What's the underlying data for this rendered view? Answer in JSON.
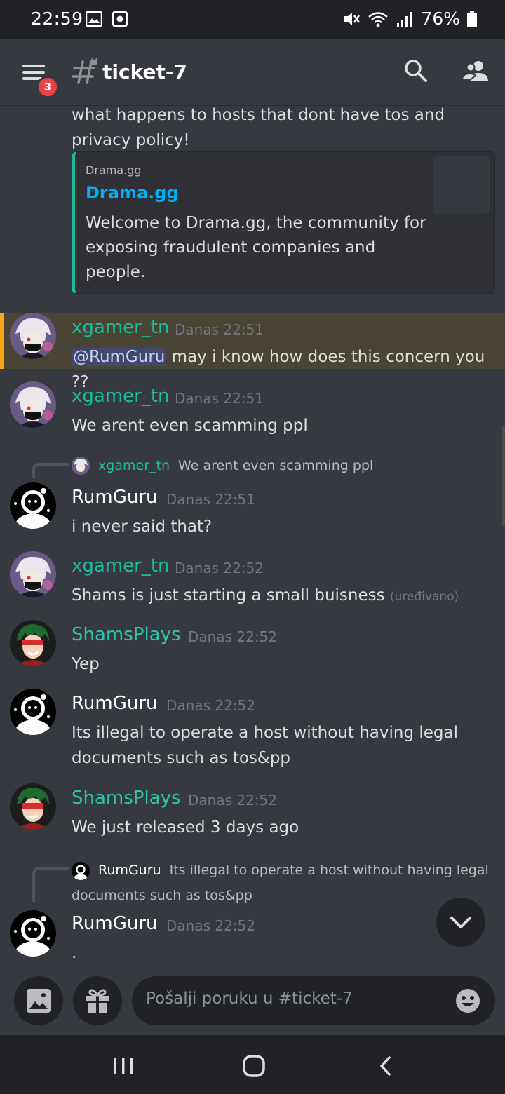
{
  "status_bar": {
    "time": "22:59",
    "battery": "76%",
    "icons": [
      "image-icon",
      "media-icon",
      "mute-icon",
      "wifi-icon",
      "signal-icon",
      "battery-icon"
    ]
  },
  "header": {
    "badge_count": "3",
    "channel_name": "ticket-7",
    "icons": [
      "menu-icon",
      "locked-hash-icon",
      "search-icon",
      "members-icon"
    ]
  },
  "messages": {
    "m0": {
      "text": "what happens to hosts that dont have tos and privacy policy!",
      "embed": {
        "provider": "Drama.gg",
        "title": "Drama.gg",
        "description": "Welcome to Drama.gg, the community for exposing fraudulent companies and people."
      }
    },
    "m1": {
      "author": "xgamer_tn",
      "time": "Danas 22:51",
      "mention": "@RumGuru",
      "text": " may i know how does this concern you ??"
    },
    "m2": {
      "author": "xgamer_tn",
      "time": "Danas 22:51",
      "text": "We arent even scamming ppl"
    },
    "m3": {
      "reply_author": "xgamer_tn",
      "reply_text": "We arent even scamming ppl",
      "author": "RumGuru",
      "time": "Danas 22:51",
      "text": "i never said that?"
    },
    "m4": {
      "author": "xgamer_tn",
      "time": "Danas 22:52",
      "text": "Shams is just starting a small buisness",
      "edited": "(uređivano)"
    },
    "m5": {
      "author": "ShamsPlays",
      "time": "Danas 22:52",
      "text": "Yep"
    },
    "m6": {
      "author": "RumGuru",
      "time": "Danas 22:52",
      "text": "Its illegal to operate a host without having legal documents such as tos&pp"
    },
    "m7": {
      "author": "ShamsPlays",
      "time": "Danas 22:52",
      "text": "We just released 3 days ago"
    },
    "m8": {
      "reply_author": "RumGuru",
      "reply_text": "Its illegal to operate a host without having legal documents such as tos&pp",
      "author": "RumGuru",
      "time": "Danas 22:52",
      "text": "."
    }
  },
  "input": {
    "placeholder": "Pošalji poruku u #ticket-7",
    "icons": [
      "image-upload-icon",
      "gift-icon",
      "emoji-icon"
    ]
  },
  "colors": {
    "background": "#36393f",
    "dark": "#202225",
    "embed_bar": "#1abc9c",
    "link": "#00b0f4",
    "highlight": "#faa61a",
    "badge": "#ed4245",
    "username_xgamer": "#1abc9c",
    "username_shams": "#2bc5a8"
  },
  "nav": {
    "icons": [
      "recent-apps-icon",
      "home-icon",
      "back-icon"
    ]
  }
}
